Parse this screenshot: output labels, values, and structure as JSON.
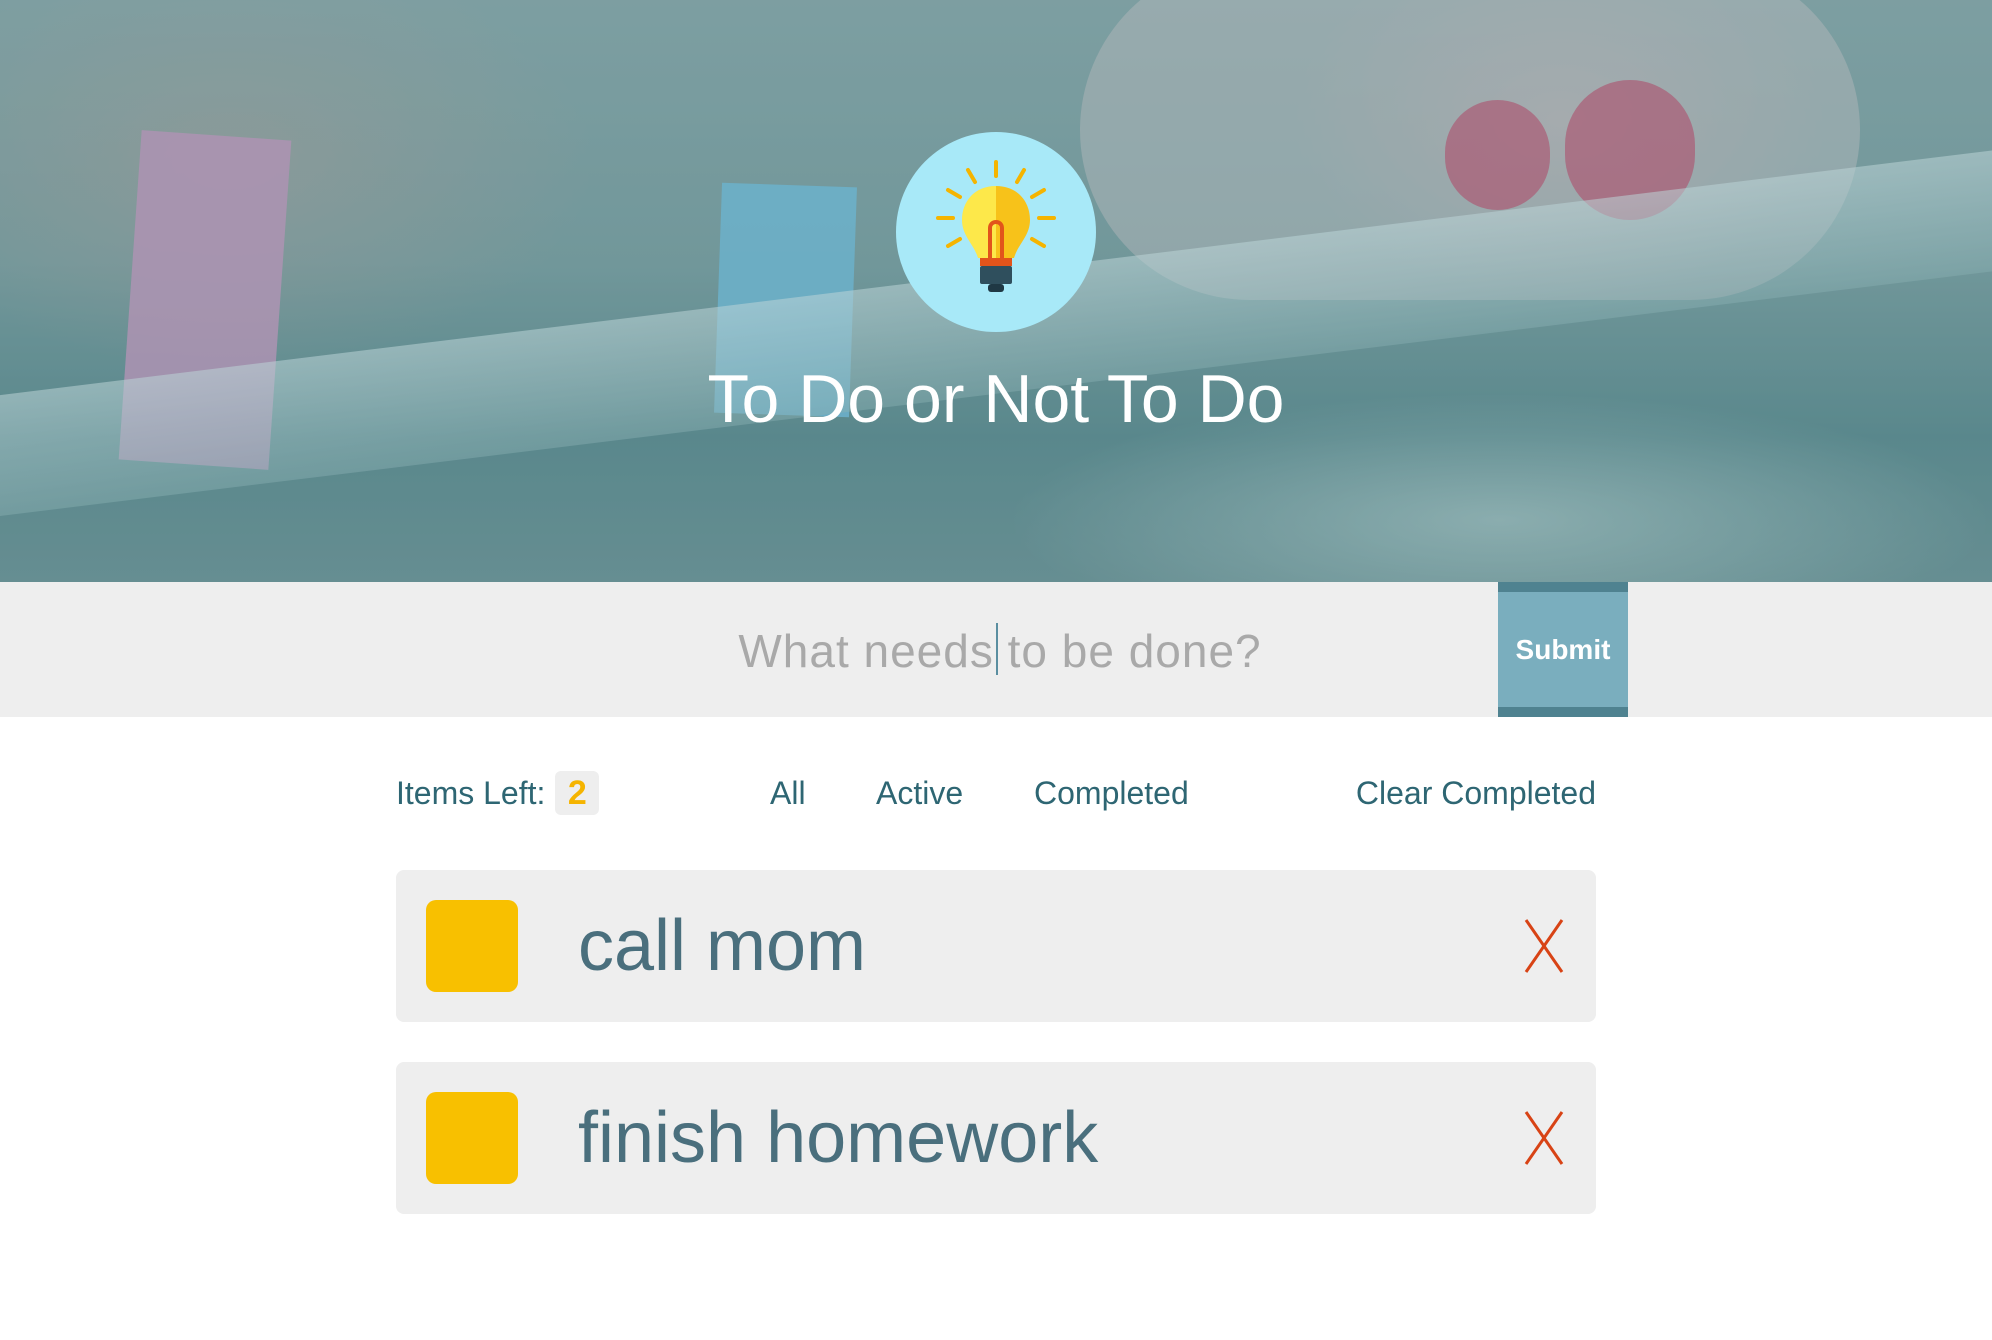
{
  "header": {
    "title": "To Do or Not To Do",
    "logo_icon": "lightbulb-icon"
  },
  "new_todo": {
    "value": "",
    "placeholder": "What needs to be done?",
    "submit_label": "Submit"
  },
  "controls": {
    "items_left_label": "Items Left:",
    "items_left_count": "2",
    "filters": [
      "All",
      "Active",
      "Completed"
    ],
    "clear_completed_label": "Clear Completed"
  },
  "todos": [
    {
      "text": "call mom",
      "completed": false
    },
    {
      "text": "finish homework",
      "completed": false
    }
  ],
  "colors": {
    "accent": "#f8c000",
    "primary_text": "#2e6673",
    "delete": "#d84315",
    "submit": "#7aaebe"
  },
  "icons": {
    "delete": "close-x-icon",
    "checkbox": "checkbox-icon"
  }
}
